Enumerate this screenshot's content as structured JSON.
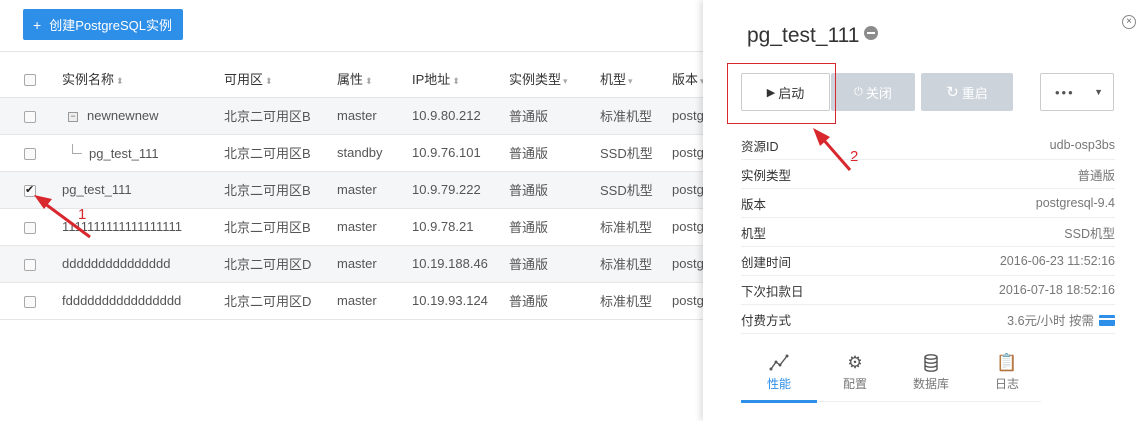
{
  "toolbar": {
    "create_label": "创建PostgreSQL实例",
    "plus": "+"
  },
  "table": {
    "headers": [
      "实例名称",
      "可用区",
      "属性",
      "IP地址",
      "实例类型",
      "机型",
      "版本"
    ],
    "rows": [
      {
        "name": "newnewnew",
        "zone": "北京二可用区B",
        "role": "master",
        "ip": "10.9.80.212",
        "type": "普通版",
        "model": "标准机型",
        "ver": "postg",
        "checked": false,
        "tree": "parent",
        "gray": true
      },
      {
        "name": "pg_test_111",
        "zone": "北京二可用区B",
        "role": "standby",
        "ip": "10.9.76.101",
        "type": "普通版",
        "model": "SSD机型",
        "ver": "postg",
        "checked": false,
        "tree": "child",
        "gray": false
      },
      {
        "name": "pg_test_111",
        "zone": "北京二可用区B",
        "role": "master",
        "ip": "10.9.79.222",
        "type": "普通版",
        "model": "SSD机型",
        "ver": "postg",
        "checked": true,
        "tree": "none",
        "gray": true
      },
      {
        "name": "1111111111111111111",
        "zone": "北京二可用区B",
        "role": "master",
        "ip": "10.9.78.21",
        "type": "普通版",
        "model": "标准机型",
        "ver": "postg",
        "checked": false,
        "tree": "none",
        "gray": false
      },
      {
        "name": "ddddddddddddddd",
        "zone": "北京二可用区D",
        "role": "master",
        "ip": "10.19.188.46",
        "type": "普通版",
        "model": "标准机型",
        "ver": "postg",
        "checked": false,
        "tree": "none",
        "gray": true
      },
      {
        "name": "fdddddddddddddddd",
        "zone": "北京二可用区D",
        "role": "master",
        "ip": "10.19.93.124",
        "type": "普通版",
        "model": "标准机型",
        "ver": "postg",
        "checked": false,
        "tree": "none",
        "gray": false
      }
    ]
  },
  "drawer": {
    "title": "pg_test_111",
    "close": "×",
    "buttons": {
      "start": "启动",
      "stop": "关闭",
      "restart": "重启",
      "more": "•••"
    },
    "info": [
      {
        "k": "资源ID",
        "v": "udb-osp3bs"
      },
      {
        "k": "实例类型",
        "v": "普通版"
      },
      {
        "k": "版本",
        "v": "postgresql-9.4"
      },
      {
        "k": "机型",
        "v": "SSD机型"
      },
      {
        "k": "创建时间",
        "v": "2016-06-23 11:52:16"
      },
      {
        "k": "下次扣款日",
        "v": "2016-07-18 18:52:16"
      },
      {
        "k": "付费方式",
        "v": "3.6元/小时 按需"
      }
    ],
    "tabs": [
      "性能",
      "配置",
      "数据库",
      "日志"
    ]
  },
  "annotations": {
    "n1": "1",
    "n2": "2"
  },
  "colors": {
    "accent": "#2e8fe8",
    "annotation": "#d9272e",
    "disabled_btn": "#cdd3da"
  }
}
